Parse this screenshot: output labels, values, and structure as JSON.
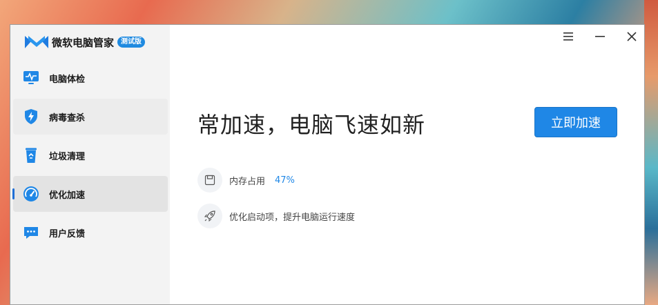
{
  "app": {
    "name": "微软电脑管家",
    "badge": "测试版"
  },
  "window_controls": {
    "menu_icon": "hamburger-icon",
    "minimize_icon": "minimize-icon",
    "close_icon": "close-icon"
  },
  "sidebar": {
    "items": [
      {
        "label": "电脑体检",
        "icon": "monitor-pulse-icon",
        "active": false
      },
      {
        "label": "病毒查杀",
        "icon": "shield-bolt-icon",
        "active": false
      },
      {
        "label": "垃圾清理",
        "icon": "recycle-bin-icon",
        "active": false
      },
      {
        "label": "优化加速",
        "icon": "speedometer-icon",
        "active": true
      },
      {
        "label": "用户反馈",
        "icon": "chat-bubble-icon",
        "active": false
      }
    ]
  },
  "main": {
    "headline": "常加速，电脑飞速如新",
    "cta_label": "立即加速",
    "memory": {
      "label": "内存占用",
      "value": "47%",
      "icon": "save-disk-icon"
    },
    "startup": {
      "label": "优化启动项，提升电脑运行速度",
      "icon": "rocket-icon"
    }
  },
  "colors": {
    "accent": "#1f87e6",
    "sidebar_bg": "#f3f3f3",
    "active_bg": "#e3e3e3"
  }
}
